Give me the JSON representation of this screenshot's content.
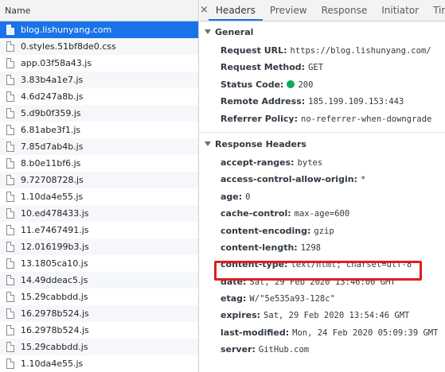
{
  "list": {
    "header": "Name",
    "items": [
      {
        "name": "blog.lishunyang.com",
        "selected": true
      },
      {
        "name": "0.styles.51bf8de0.css"
      },
      {
        "name": "app.03f58a43.js"
      },
      {
        "name": "3.83b4a1e7.js"
      },
      {
        "name": "4.6d247a8b.js"
      },
      {
        "name": "5.d9b0f359.js"
      },
      {
        "name": "6.81abe3f1.js"
      },
      {
        "name": "7.85d7ab4b.js"
      },
      {
        "name": "8.b0e11bf6.js"
      },
      {
        "name": "9.72708728.js"
      },
      {
        "name": "1.10da4e55.js"
      },
      {
        "name": "10.ed478433.js"
      },
      {
        "name": "11.e7467491.js"
      },
      {
        "name": "12.016199b3.js"
      },
      {
        "name": "13.1805ca10.js"
      },
      {
        "name": "14.49ddeac5.js"
      },
      {
        "name": "15.29cabbdd.js"
      },
      {
        "name": "16.2978b524.js"
      },
      {
        "name": "16.2978b524.js"
      },
      {
        "name": "15.29cabbdd.js"
      },
      {
        "name": "1.10da4e55.js"
      }
    ]
  },
  "tabs": {
    "close": "×",
    "items": [
      "Headers",
      "Preview",
      "Response",
      "Initiator",
      "Timing"
    ],
    "active": "Headers"
  },
  "general": {
    "title": "General",
    "request_url": {
      "key": "Request URL:",
      "value": "https://blog.lishunyang.com/"
    },
    "request_method": {
      "key": "Request Method:",
      "value": "GET"
    },
    "status_code": {
      "key": "Status Code:",
      "value": "200",
      "dot_color": "#0fa95b"
    },
    "remote_address": {
      "key": "Remote Address:",
      "value": "185.199.109.153:443"
    },
    "referrer_policy": {
      "key": "Referrer Policy:",
      "value": "no-referrer-when-downgrade"
    }
  },
  "response_headers": {
    "title": "Response Headers",
    "items": [
      {
        "key": "accept-ranges:",
        "value": "bytes"
      },
      {
        "key": "access-control-allow-origin:",
        "value": "*"
      },
      {
        "key": "age:",
        "value": "0"
      },
      {
        "key": "cache-control:",
        "value": "max-age=600"
      },
      {
        "key": "content-encoding:",
        "value": "gzip"
      },
      {
        "key": "content-length:",
        "value": "1298"
      },
      {
        "key": "content-type:",
        "value": "text/html; charset=utf-8",
        "highlighted": true
      },
      {
        "key": "date:",
        "value": "Sat, 29 Feb 2020 13:46:00 GMT"
      },
      {
        "key": "etag:",
        "value": "W/\"5e535a93-128c\""
      },
      {
        "key": "expires:",
        "value": "Sat, 29 Feb 2020 13:54:46 GMT"
      },
      {
        "key": "last-modified:",
        "value": "Mon, 24 Feb 2020 05:09:39 GMT"
      },
      {
        "key": "server:",
        "value": "GitHub.com"
      }
    ]
  },
  "colors": {
    "selection": "#1a73e8",
    "highlight_border": "#e01e1e",
    "status_ok": "#0fa95b"
  }
}
